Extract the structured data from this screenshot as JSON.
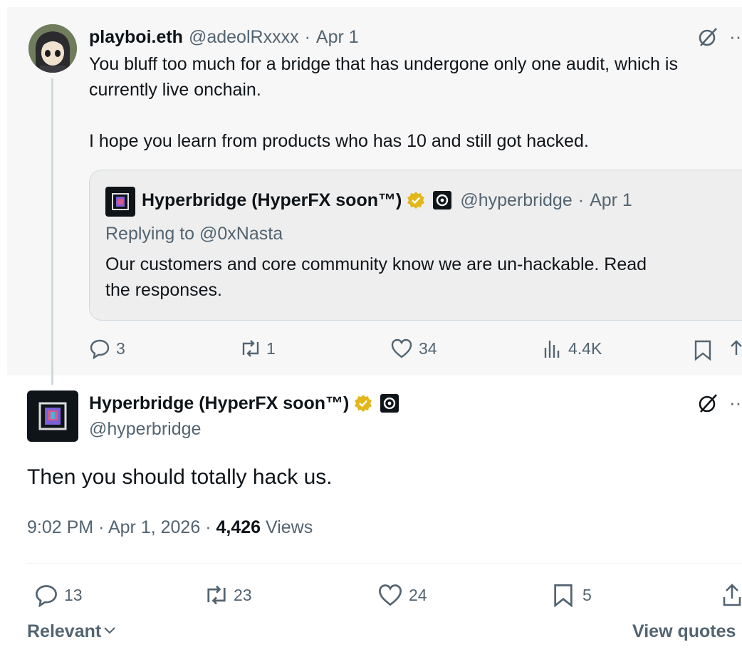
{
  "parent_tweet": {
    "display_name": "playboi.eth",
    "handle": "@adeolRxxxx",
    "date": "Apr 1",
    "separator": "·",
    "text_line1": "You bluff too much for a bridge that has undergone only one audit, which is",
    "text_line2": "currently live onchain.",
    "text_line3": "I hope you learn from products who has 10 and still got hacked.",
    "quote": {
      "display_name": "Hyperbridge (HyperFX soon™)",
      "handle": "@hyperbridge",
      "date": "Apr 1",
      "separator": "·",
      "replying_to": "Replying to @0xNasta",
      "text_line1": "Our customers and core community know we are un-hackable. Read",
      "text_line2": "the responses."
    },
    "actions": {
      "replies": "3",
      "reposts": "1",
      "likes": "34",
      "views": "4.4K"
    }
  },
  "main_tweet": {
    "display_name": "Hyperbridge (HyperFX soon™)",
    "handle": "@hyperbridge",
    "text": "Then you should totally hack us.",
    "time": "9:02 PM",
    "date": "Apr 1, 2026",
    "sep1": "·",
    "sep2": "·",
    "views_count": "4,426",
    "views_label": "Views",
    "actions": {
      "replies": "13",
      "reposts": "23",
      "likes": "24",
      "bookmarks": "5"
    }
  },
  "footer": {
    "sort_label": "Relevant",
    "view_quotes": "View quotes"
  },
  "colors": {
    "text": "#0f1419",
    "muted": "#536471",
    "verified_gold": "#e2b719",
    "thread_line": "#cfd9de"
  }
}
